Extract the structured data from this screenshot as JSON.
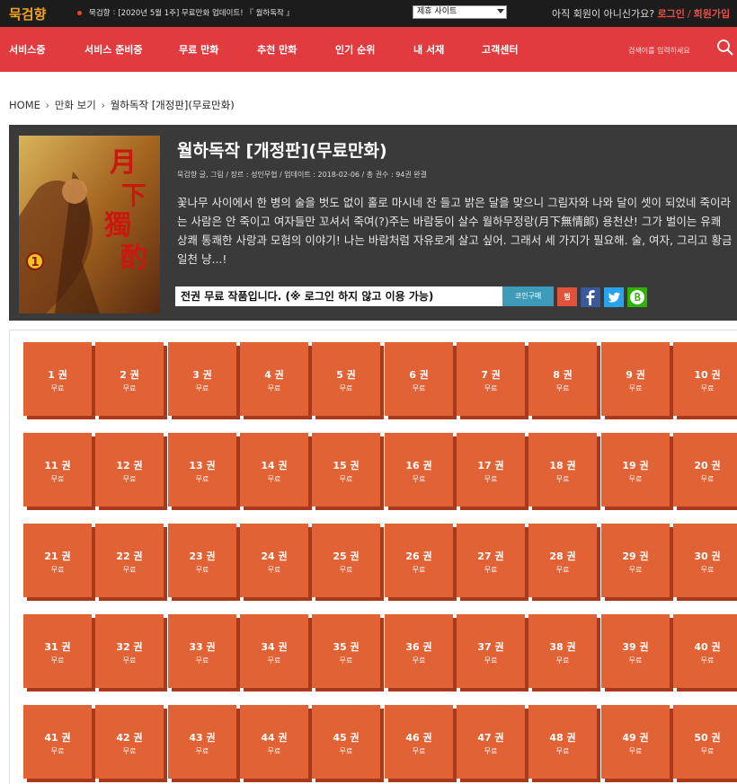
{
  "topbar": {
    "logo": "묵검향",
    "notice_label": "묵검향",
    "notice_text": "[2020년 5월 1주] 무료만화 업데이트! 『 월하독작 』",
    "partner_select": "제휴 사이트",
    "member_question": "아직 회원이 아니신가요?",
    "login": "로그인",
    "join": "회원가입"
  },
  "nav": {
    "items": [
      "서비스중",
      "서비스 준비중",
      "무료 만화",
      "추천 만화",
      "인기 순위",
      "내 서재",
      "고객센터"
    ],
    "search_placeholder": "검색어를 입력하세요"
  },
  "breadcrumb": {
    "home": "HOME",
    "section": "만화 보기",
    "current": "월하독작 [개정판](무료만화)"
  },
  "work": {
    "title": "월하독작 [개정판](무료만화)",
    "meta": "묵검향 글, 그림 / 장르 : 성인무협 / 업데이트 : 2018-02-06 / 총 권수 : 94권 완결",
    "description": "꽃나무 사이에서 한 병의 술을 벗도 없이 홀로 마시네 잔 들고 밝은 달을 맞으니 그림자와 나와 달이 셋이 되었네 죽이라는 사람은 안 죽이고 여자들만 꼬셔서 죽여(?)주는 바람둥이 살수 월하무정랑(月下無情郞) 용천산! 그가 벌이는 유쾌 상쾌 통쾌한 사랑과 모험의 이야기! 나는 바람처럼 자유로게 살고 싶어. 그래서 세 가지가 필요해. 술, 여자, 그리고 황금 일천 냥...!",
    "free_notice": "전권 무료 작품입니다. (※ 로그인 하지 않고 이용 가능)",
    "coin_button": "코인구매",
    "bookmark_button": "찜",
    "cover_chars": [
      "月",
      "下",
      "獨",
      "酌"
    ],
    "cover_volume": "1"
  },
  "volumes": {
    "price_label": "무료",
    "list": [
      "1 권",
      "2 권",
      "3 권",
      "4 권",
      "5 권",
      "6 권",
      "7 권",
      "8 권",
      "9 권",
      "10 권",
      "11 권",
      "12 권",
      "13 권",
      "14 권",
      "15 권",
      "16 권",
      "17 권",
      "18 권",
      "19 권",
      "20 권",
      "21 권",
      "22 권",
      "23 권",
      "24 권",
      "25 권",
      "26 권",
      "27 권",
      "28 권",
      "29 권",
      "30 권",
      "31 권",
      "32 권",
      "33 권",
      "34 권",
      "35 권",
      "36 권",
      "37 권",
      "38 권",
      "39 권",
      "40 권",
      "41 권",
      "42 권",
      "43 권",
      "44 권",
      "45 권",
      "46 권",
      "47 권",
      "48 권",
      "49 권",
      "50 권"
    ]
  },
  "colors": {
    "nav": "#e13b3f",
    "topbar": "#1c1c1c",
    "volume_tile": "#e06235",
    "accent_login": "#ef4b46"
  }
}
